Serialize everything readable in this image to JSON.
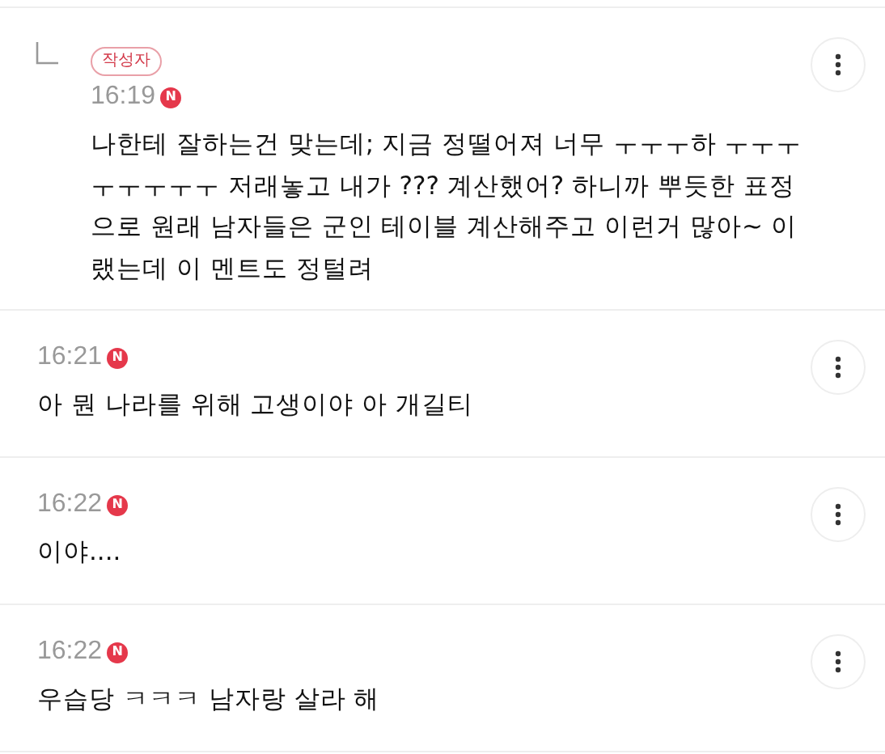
{
  "comments": [
    {
      "is_reply": true,
      "author_badge": "작성자",
      "time": "16:19",
      "new_badge": "N",
      "text": "나한테 잘하는건 맞는데; 지금 정떨어져 너무 ㅜㅜㅜ하 ㅜㅜㅜㅜㅜㅜㅜㅜ 저래놓고 내가 ??? 계산했어? 하니까 뿌듯한 표정으로 원래 남자들은 군인 테이블 계산해주고 이런거 많아~ 이랬는데 이 멘트도 정털려"
    },
    {
      "is_reply": false,
      "time": "16:21",
      "new_badge": "N",
      "text": "아 뭔 나라를 위해 고생이야 아 개길티"
    },
    {
      "is_reply": false,
      "time": "16:22",
      "new_badge": "N",
      "text": "이야...."
    },
    {
      "is_reply": false,
      "time": "16:22",
      "new_badge": "N",
      "text": "우습당 ㅋㅋㅋ 남자랑 살라 해"
    }
  ]
}
